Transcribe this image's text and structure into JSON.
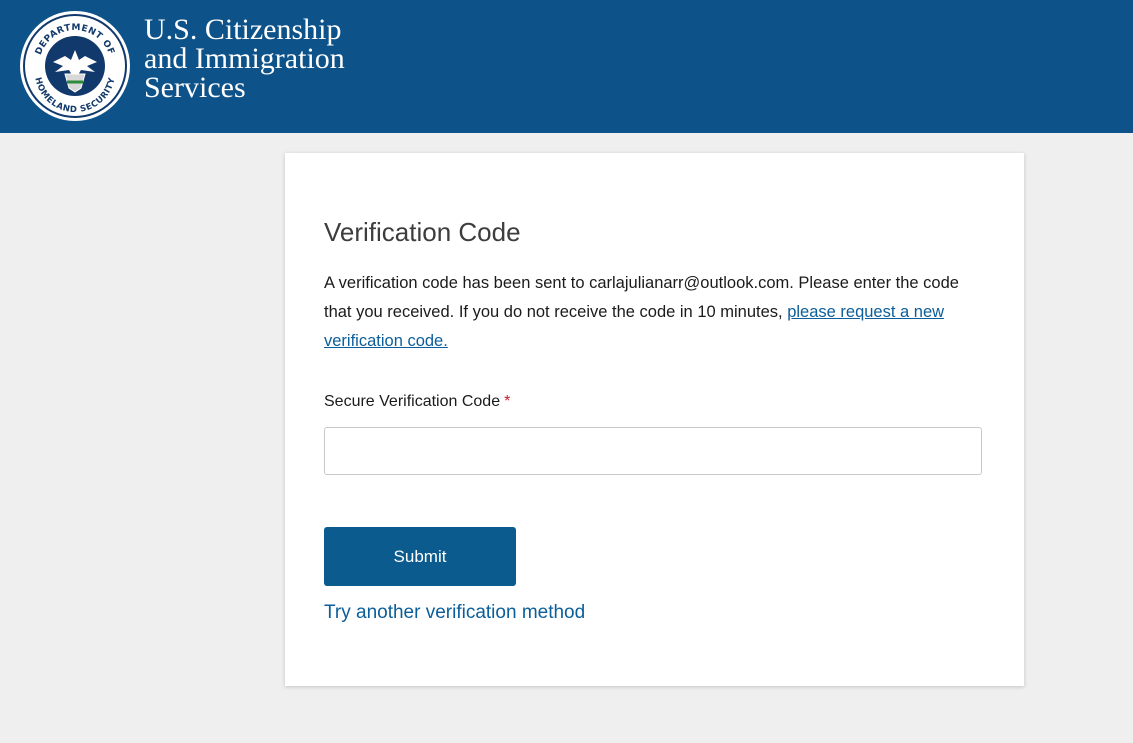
{
  "header": {
    "agency_name_line1": "U.S. Citizenship",
    "agency_name_line2": "and Immigration",
    "agency_name_line3": "Services",
    "seal_icon": "dhs-seal-icon",
    "seal_text_top": "DEPARTMENT OF",
    "seal_text_bottom": "HOMELAND SECURITY",
    "background_color": "#0d5289"
  },
  "card": {
    "title": "Verification Code",
    "description_text": "A verification code has been sent to carlajulianarr@outlook.com. Please enter the code that you received. If you do not receive the code in 10 minutes, ",
    "request_link_text": "please request a new verification code.",
    "field_label": "Secure Verification Code",
    "required_marker": "*",
    "code_value": "",
    "code_placeholder": "",
    "submit_label": "Submit",
    "alt_method_link": "Try another verification method"
  },
  "colors": {
    "page_background": "#efefef",
    "accent": "#0b5b8e",
    "link": "#0b5e99",
    "required": "#c0202a"
  }
}
